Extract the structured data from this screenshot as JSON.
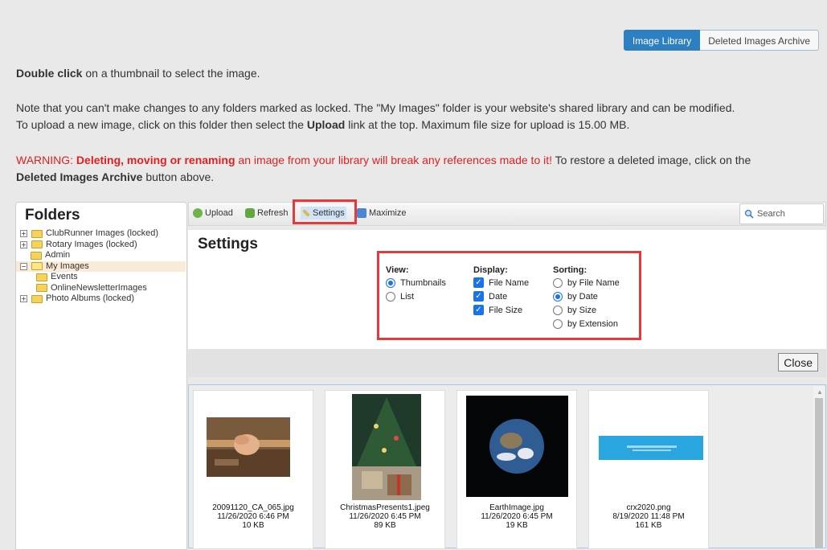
{
  "tabs": {
    "image_library": "Image Library",
    "deleted_archive": "Deleted Images Archive"
  },
  "intro": {
    "bold": "Double click",
    "rest": " on a thumbnail to select the image."
  },
  "note": {
    "line1": "Note that you can't make changes to any folders marked as locked. The \"My Images\" folder is your website's shared library and can be modified.",
    "line2_a": "To upload a new image, click on this folder then select the ",
    "line2_bold": "Upload",
    "line2_b": " link at the top. Maximum file size for upload is 15.00 MB."
  },
  "warning": {
    "prefix": "WARNING: ",
    "bold": "Deleting, moving or renaming",
    "mid": " an image from your library will break any references made to it!",
    "tail": " To restore a deleted image, click on the",
    "bold2": "Deleted Images Archive",
    "end": " button above."
  },
  "folders": {
    "title": "Folders",
    "items": [
      {
        "label": "ClubRunner Images (locked)"
      },
      {
        "label": "Rotary Images (locked)"
      },
      {
        "label": "Admin"
      },
      {
        "label": "My Images"
      },
      {
        "label": "Events"
      },
      {
        "label": "OnlineNewsletterImages"
      },
      {
        "label": "Photo Albums (locked)"
      }
    ]
  },
  "toolbar": {
    "upload": "Upload",
    "refresh": "Refresh",
    "settings": "Settings",
    "maximize": "Maximize",
    "search": "Search"
  },
  "settings": {
    "title": "Settings",
    "view": {
      "title": "View:",
      "options": [
        "Thumbnails",
        "List"
      ],
      "selected": "Thumbnails"
    },
    "display": {
      "title": "Display:",
      "options": [
        "File Name",
        "Date",
        "File Size"
      ],
      "checked": [
        "File Name",
        "Date",
        "File Size"
      ]
    },
    "sorting": {
      "title": "Sorting:",
      "options": [
        "by File Name",
        "by Date",
        "by Size",
        "by Extension"
      ],
      "selected": "by Date"
    },
    "close": "Close"
  },
  "images": [
    {
      "name": "20091120_CA_065.jpg",
      "date": "11/26/2020 6:46 PM",
      "size": "10 KB"
    },
    {
      "name": "ChristmasPresents1.jpeg",
      "date": "11/26/2020 6:45 PM",
      "size": "89 KB"
    },
    {
      "name": "EarthImage.jpg",
      "date": "11/26/2020 6:45 PM",
      "size": "19 KB"
    },
    {
      "name": "crx2020.png",
      "date": "8/19/2020 11:48 PM",
      "size": "161 KB"
    }
  ],
  "colors": {
    "accent": "#2c7fc0",
    "warning": "#e02020",
    "highlight": "#e33b3b",
    "checkbox": "#1a73e8"
  }
}
